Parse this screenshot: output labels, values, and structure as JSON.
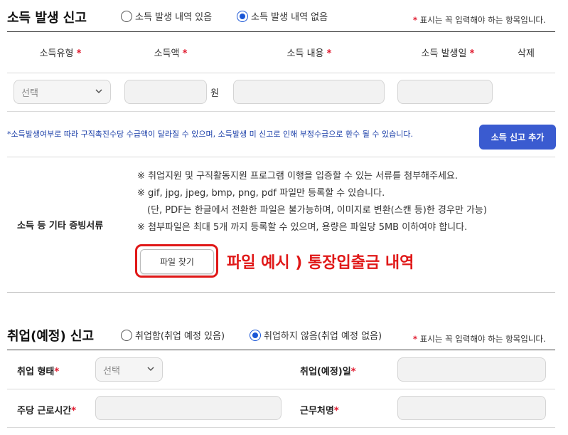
{
  "income": {
    "title": "소득 발생 신고",
    "radio_yes": "소득 발생 내역 있음",
    "radio_no": "소득 발생 내역 없음",
    "selected": "no",
    "required_note": "표시는 꼭 입력해야 하는 항목입니다.",
    "columns": {
      "type": "소득유형",
      "amount": "소득액",
      "content": "소득 내용",
      "date": "소득 발생일",
      "delete": "삭제"
    },
    "type_select": "선택",
    "currency_unit": "원",
    "notice": "*소득발생여부로 따라 구직촉진수당 수급액이 달라질 수 있으며, 소득발생 미 신고로 인해 부정수급으로 환수 될 수 있습니다.",
    "add_button": "소득 신고 추가"
  },
  "evidence": {
    "label": "소득 등 기타 증빙서류",
    "guide1": "※ 취업지원 및 구직활동지원 프로그램 이행을 입증할 수 있는 서류를 첨부해주세요.",
    "guide2": "※ gif, jpg, jpeg, bmp, png, pdf 파일만 등록할 수 있습니다.",
    "guide3": "(단, PDF는 한글에서 전환한 파일은 불가능하며, 이미지로 변환(스캔 등)한 경우만 가능)",
    "guide4": "※ 첨부파일은 최대 5개 까지 등록할 수 있으며, 용량은 파일당 5MB 이하여야 합니다.",
    "file_button": "파일 찾기",
    "annotation": "파일 예시 ) 통장입출금 내역"
  },
  "employment": {
    "title": "취업(예정) 신고",
    "radio_yes": "취업함(취업 예정 있음)",
    "radio_no": "취업하지 않음(취업 예정 없음)",
    "selected": "no",
    "required_note": "표시는 꼭 입력해야 하는 항목입니다.",
    "type_label": "취업 형태",
    "type_select": "선택",
    "date_label": "취업(예정)일",
    "hours_label": "주당 근로시간",
    "workplace_label": "근무처명"
  },
  "colors": {
    "accent": "#3a5bd0",
    "radio_selected": "#1a56d6",
    "required_star": "#e0182d",
    "annotation_red": "#e01818"
  }
}
